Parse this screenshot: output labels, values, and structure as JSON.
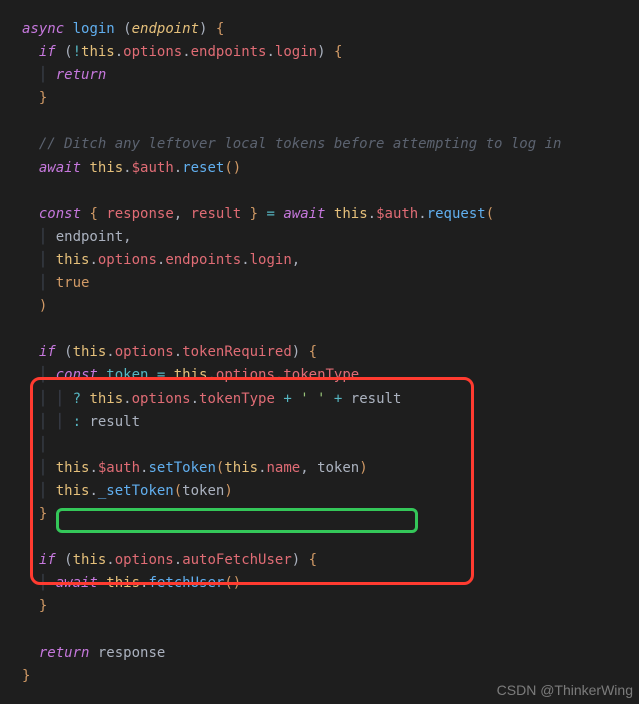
{
  "code": {
    "l1_async": "async",
    "l1_login": "login",
    "l1_lp": " (",
    "l1_endpoint": "endpoint",
    "l1_rp": ")",
    "l1_lb": " {",
    "l2_if": "if",
    "l2_lp": " (",
    "l2_not": "!",
    "l2_this": "this",
    "l2_d1": ".",
    "l2_options": "options",
    "l2_d2": ".",
    "l2_endpoints": "endpoints",
    "l2_d3": ".",
    "l2_loginprop": "login",
    "l2_rp": ")",
    "l2_lb": " {",
    "l3_return": "return",
    "l4_rb": "}",
    "l6_comment": "// Ditch any leftover local tokens before attempting to log in",
    "l7_await": "await",
    "l7_this": " this",
    "l7_d1": ".",
    "l7_auth": "$auth",
    "l7_d2": ".",
    "l7_reset": "reset",
    "l7_par": "()",
    "l9_const": "const",
    "l9_lb": " { ",
    "l9_response": "response",
    "l9_comma": ", ",
    "l9_result": "result",
    "l9_rb": " }",
    "l9_eq": " = ",
    "l9_await": "await",
    "l9_this": " this",
    "l9_d1": ".",
    "l9_auth": "$auth",
    "l9_d2": ".",
    "l9_request": "request",
    "l9_lp": "(",
    "l10_endpoint": "endpoint",
    "l10_c": ",",
    "l11_this": "this",
    "l11_d1": ".",
    "l11_options": "options",
    "l11_d2": ".",
    "l11_endpoints": "endpoints",
    "l11_d3": ".",
    "l11_login": "login",
    "l11_c": ",",
    "l12_true": "true",
    "l13_rp": ")",
    "l15_if": "if",
    "l15_lp": " (",
    "l15_this": "this",
    "l15_d1": ".",
    "l15_options": "options",
    "l15_d2": ".",
    "l15_tokenRequired": "tokenRequired",
    "l15_rp": ")",
    "l15_lb": " {",
    "l16_const": "const",
    "l16_token": " token",
    "l16_eq": " = ",
    "l16_this": "this",
    "l16_d1": ".",
    "l16_options": "options",
    "l16_d2": ".",
    "l16_tokenType": "tokenType",
    "l17_q": "? ",
    "l17_this": "this",
    "l17_d1": ".",
    "l17_options": "options",
    "l17_d2": ".",
    "l17_tokenType": "tokenType",
    "l17_plus1": " + ",
    "l17_str": "' '",
    "l17_plus2": " + ",
    "l17_result": "result",
    "l18_colon": ": ",
    "l18_result": "result",
    "l20_this": "this",
    "l20_d1": ".",
    "l20_auth": "$auth",
    "l20_d2": ".",
    "l20_setToken": "setToken",
    "l20_lp": "(",
    "l20_this2": "this",
    "l20_d3": ".",
    "l20_name": "name",
    "l20_comma": ", ",
    "l20_token": "token",
    "l20_rp": ")",
    "l21_this": "this",
    "l21_d1": ".",
    "l21_setToken": "_setToken",
    "l21_lp": "(",
    "l21_token": "token",
    "l21_rp": ")",
    "l22_rb": "}",
    "l24_if": "if",
    "l24_lp": " (",
    "l24_this": "this",
    "l24_d1": ".",
    "l24_options": "options",
    "l24_d2": ".",
    "l24_autoFetchUser": "autoFetchUser",
    "l24_rp": ")",
    "l24_lb": " {",
    "l25_await": "await",
    "l25_this": " this",
    "l25_d1": ".",
    "l25_fetchUser": "fetchUser",
    "l25_par": "()",
    "l26_rb": "}",
    "l28_return": "return",
    "l28_response": " response",
    "l29_rb": "}"
  },
  "watermark": "CSDN @ThinkerWing"
}
